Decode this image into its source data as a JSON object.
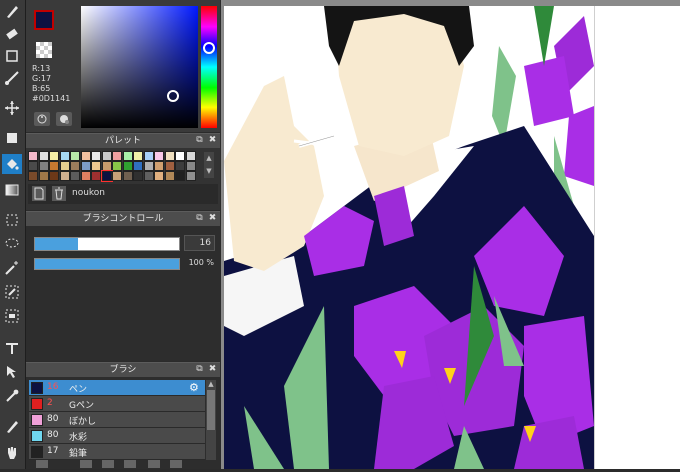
{
  "color": {
    "rgb_r": "R:13",
    "rgb_g": "G:17",
    "rgb_b": "B:65",
    "hex": "#0D1141",
    "primary": "#0D1141",
    "secondary": "#FFFFFF"
  },
  "palette": {
    "title": "パレット",
    "name": "noukon",
    "swatches": [
      "#f4b9c9",
      "#e0e0e0",
      "#f7f0a6",
      "#a6d9f2",
      "#b8e8a8",
      "#f2c0a0",
      "#e8e8e8",
      "#c8c8c8",
      "#f0a0a0",
      "#a8f0a8",
      "#f0f0a8",
      "#a8d0f8",
      "#f8c8e8",
      "#f0e0c0",
      "#ffffff",
      "#d8d8d8",
      "#4a4a4a",
      "#808080",
      "#c87830",
      "#e6d090",
      "#9c7c5c",
      "#7c9cc8",
      "#f0c890",
      "#c89c6c",
      "#88c848",
      "#30a030",
      "#3070c0",
      "#b0b0b0",
      "#d0a070",
      "#a06040",
      "#3c3c3c",
      "#888888",
      "#7a4a2a",
      "#a07848",
      "#6c3818",
      "#d0b090",
      "#5c5c5c",
      "#e08060",
      "#a03030",
      "#0d1141",
      "#c8a078",
      "#706050",
      "#303030",
      "#606060",
      "#e0b080",
      "#b08858",
      "#202020",
      "#909090"
    ]
  },
  "brush_control": {
    "title": "ブラシコントロール",
    "size_value": "16",
    "opacity_value": "100 %",
    "size_fraction": 0.3,
    "opacity_fraction": 1.0
  },
  "brush": {
    "title": "ブラシ",
    "items": [
      {
        "size": "16",
        "name": "ペン",
        "color": "#0d1141"
      },
      {
        "size": "2",
        "name": "Gペン",
        "color": "#e02020"
      },
      {
        "size": "80",
        "name": "ぼかし",
        "color": "#f0a0d8"
      },
      {
        "size": "80",
        "name": "水彩",
        "color": "#70d8f0"
      },
      {
        "size": "17",
        "name": "鉛筆",
        "color": "#222222"
      }
    ]
  },
  "canvas": {
    "accent": "#1f7fc8"
  }
}
